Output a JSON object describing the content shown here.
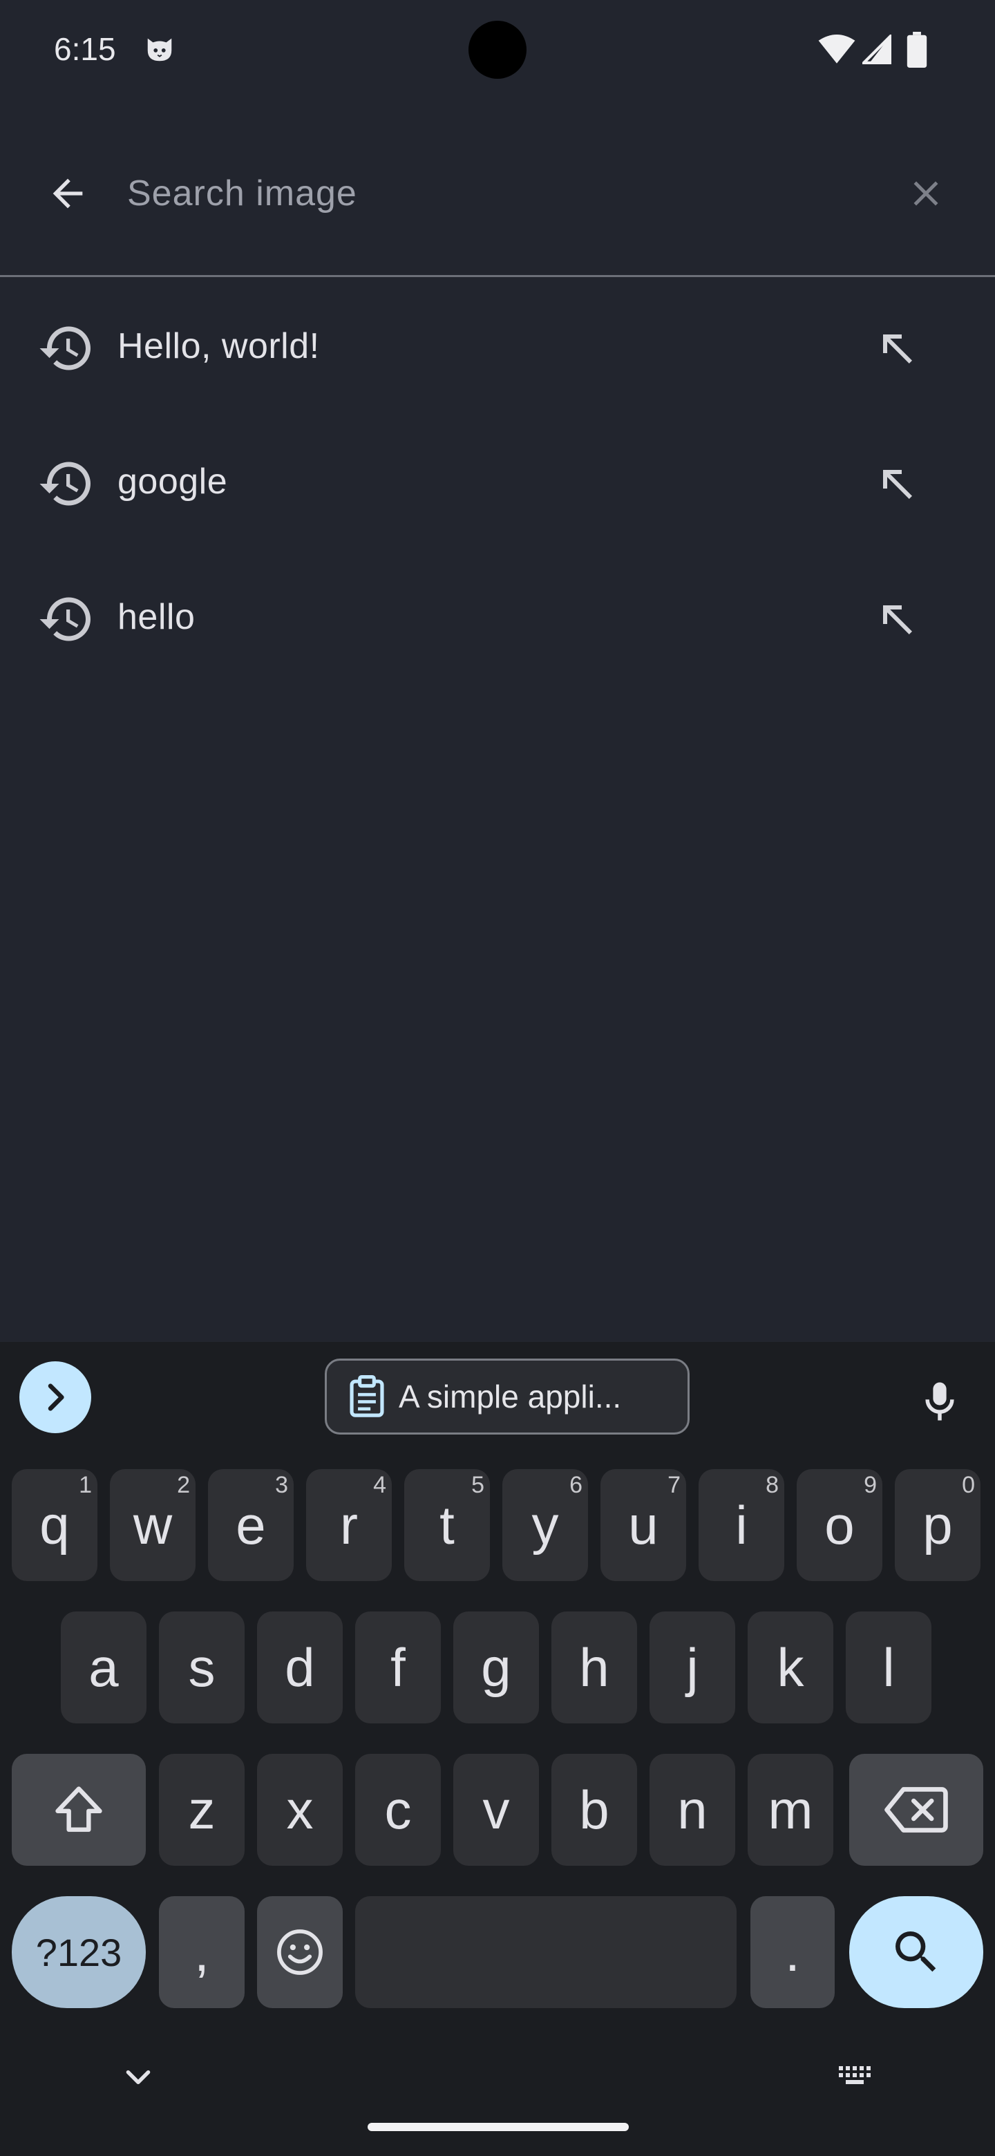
{
  "status_bar": {
    "time": "6:15",
    "icons": [
      "cat-notification-icon",
      "wifi-icon",
      "cell-signal-icon",
      "battery-icon"
    ]
  },
  "search": {
    "placeholder": "Search image",
    "value": "",
    "back_icon": "arrow-left-icon",
    "clear_icon": "close-icon"
  },
  "history": {
    "items": [
      {
        "label": "Hello, world!"
      },
      {
        "label": "google"
      },
      {
        "label": "hello"
      }
    ],
    "item_icon": "history-icon",
    "fill_icon": "arrow-up-left-icon"
  },
  "keyboard": {
    "clipboard_text": "A simple appli...",
    "row1": [
      {
        "label": "q",
        "hint": "1"
      },
      {
        "label": "w",
        "hint": "2"
      },
      {
        "label": "e",
        "hint": "3"
      },
      {
        "label": "r",
        "hint": "4"
      },
      {
        "label": "t",
        "hint": "5"
      },
      {
        "label": "y",
        "hint": "6"
      },
      {
        "label": "u",
        "hint": "7"
      },
      {
        "label": "i",
        "hint": "8"
      },
      {
        "label": "o",
        "hint": "9"
      },
      {
        "label": "p",
        "hint": "0"
      }
    ],
    "row2": [
      "a",
      "s",
      "d",
      "f",
      "g",
      "h",
      "j",
      "k",
      "l"
    ],
    "row3": [
      "z",
      "x",
      "c",
      "v",
      "b",
      "n",
      "m"
    ],
    "symbols_label": "?123",
    "comma_label": ",",
    "period_label": ".",
    "colors": {
      "accent": "#c2e7ff",
      "key": "#2f3034",
      "func_key": "#45474c",
      "background": "#1b1d21"
    }
  },
  "colors": {
    "app_background": "#22252e",
    "divider": "#6c6f78"
  }
}
